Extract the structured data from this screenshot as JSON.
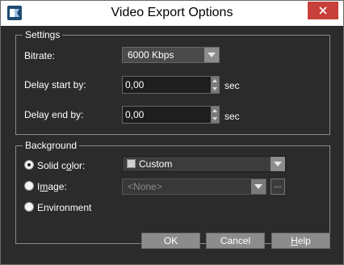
{
  "window": {
    "title": "Video Export Options"
  },
  "settings": {
    "legend": "Settings",
    "bitrate": {
      "label": "Bitrate:",
      "value": "6000 Kbps"
    },
    "delay_start": {
      "label": "Delay start by:",
      "value": "0,00",
      "unit": "sec"
    },
    "delay_end": {
      "label": "Delay end by:",
      "value": "0,00",
      "unit": "sec"
    }
  },
  "background": {
    "legend": "Background",
    "solid_color": {
      "label_pre": "Solid c",
      "label_accel": "o",
      "label_post": "lor:",
      "selected": true,
      "value": "Custom"
    },
    "image": {
      "label_pre": "I",
      "label_accel": "m",
      "label_post": "age:",
      "selected": false,
      "value": "<None>",
      "browse_label": "..."
    },
    "environment": {
      "label": "Environment",
      "selected": false
    }
  },
  "buttons": {
    "ok": "OK",
    "cancel": "Cancel",
    "help_accel": "H",
    "help_rest": "elp"
  },
  "icons": {
    "app": "app-logo-icon",
    "close": "close-icon",
    "dropdown": "chevron-down-icon"
  },
  "colors": {
    "close_button": "#c7403a",
    "dialog_background": "#2b2b2b",
    "button_gray": "#8c8c8c"
  }
}
